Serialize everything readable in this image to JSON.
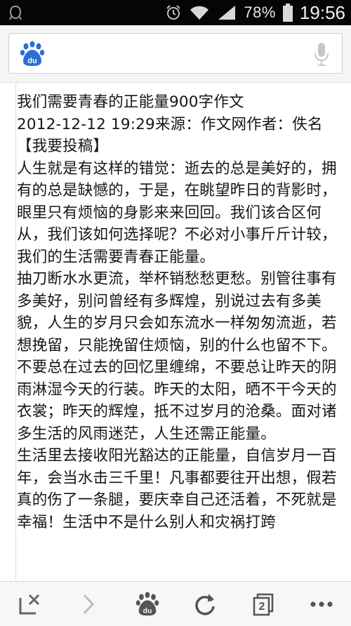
{
  "status_bar": {
    "battery_percent": "78%",
    "time": "19:56",
    "icons": [
      "notification-icon",
      "alarm-icon",
      "wifi-icon",
      "signal-icon",
      "battery-icon"
    ]
  },
  "search": {
    "placeholder": "",
    "value": "",
    "logo": "baidu-du-logo",
    "voice_icon": "microphone-icon"
  },
  "article": {
    "title": "我们需要青春的正能量900字作文",
    "meta": "2012-12-12 19:29来源：作文网作者：佚名【我要投稿】",
    "paragraphs": [
      "人生就是有这样的错觉：逝去的总是美好的，拥有的总是缺憾的，于是，在眺望昨日的背影时，眼里只有烦恼的身影来来回回。我们该合区何从，我们该如何选择呢？不必对小事斤斤计较，我们的生活需要青春正能量。",
      "抽刀断水水更流，举杯销愁愁更愁。别管往事有多美好，别问曾经有多辉煌，别说过去有多美貌，人生的岁月只会如东流水一样匆匆流逝，若想挽留，只能挽留住烦恼，别的什么也留不下。不要总在过去的回忆里缠绵，不要总让昨天的阴雨淋湿今天的行装。昨天的太阳，晒不干今天的衣裳；昨天的辉煌，抵不过岁月的沧桑。面对诸多生活的风雨迷茫，人生还需正能量。",
      "生活里去接收阳光豁达的正能量，自信岁月一百年，会当水击三千里！凡事都要往开出想，假若真的伤了一条腿，要庆幸自己还活着，不死就是幸福！生活中不是什么别人和灾祸打跨"
    ]
  },
  "toolbar": {
    "tab_count": "2",
    "icons": [
      "close-page-icon",
      "forward-icon",
      "baidu-home-icon",
      "refresh-icon",
      "tabs-icon",
      "more-icon"
    ]
  }
}
